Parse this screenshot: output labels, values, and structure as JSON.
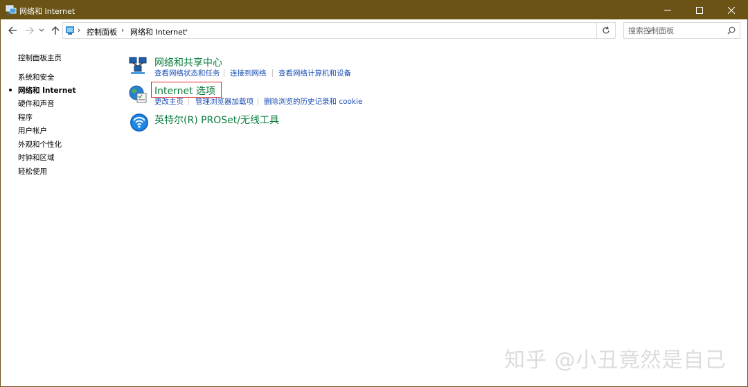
{
  "window": {
    "title": "网络和 Internet"
  },
  "nav": {
    "back": "back",
    "forward": "forward",
    "up": "up"
  },
  "address": {
    "crumbs": [
      "控制面板",
      "网络和 Internet"
    ]
  },
  "search": {
    "placeholder": "搜索控制面板"
  },
  "sidebar": {
    "items": [
      {
        "label": "控制面板主页",
        "active": false
      },
      {
        "label": "系统和安全",
        "active": false
      },
      {
        "label": "网络和 Internet",
        "active": true
      },
      {
        "label": "硬件和声音",
        "active": false
      },
      {
        "label": "程序",
        "active": false
      },
      {
        "label": "用户帐户",
        "active": false
      },
      {
        "label": "外观和个性化",
        "active": false
      },
      {
        "label": "时钟和区域",
        "active": false
      },
      {
        "label": "轻松使用",
        "active": false
      }
    ]
  },
  "categories": [
    {
      "title": "网络和共享中心",
      "icon": "network-sharing-icon",
      "links": [
        "查看网络状态和任务",
        "连接到网络",
        "查看网络计算机和设备"
      ]
    },
    {
      "title": "Internet 选项",
      "icon": "internet-options-icon",
      "links": [
        "更改主页",
        "管理浏览器加载项",
        "删除浏览的历史记录和 cookie"
      ]
    },
    {
      "title": "英特尔(R) PROSet/无线工具",
      "icon": "intel-wireless-icon",
      "links": []
    }
  ],
  "watermark": "知乎 @小丑竟然是自己",
  "colors": {
    "titlebar": "#6b5316",
    "category_title": "#0b7d3d",
    "link": "#1a4fb4",
    "highlight": "#e0232c"
  }
}
